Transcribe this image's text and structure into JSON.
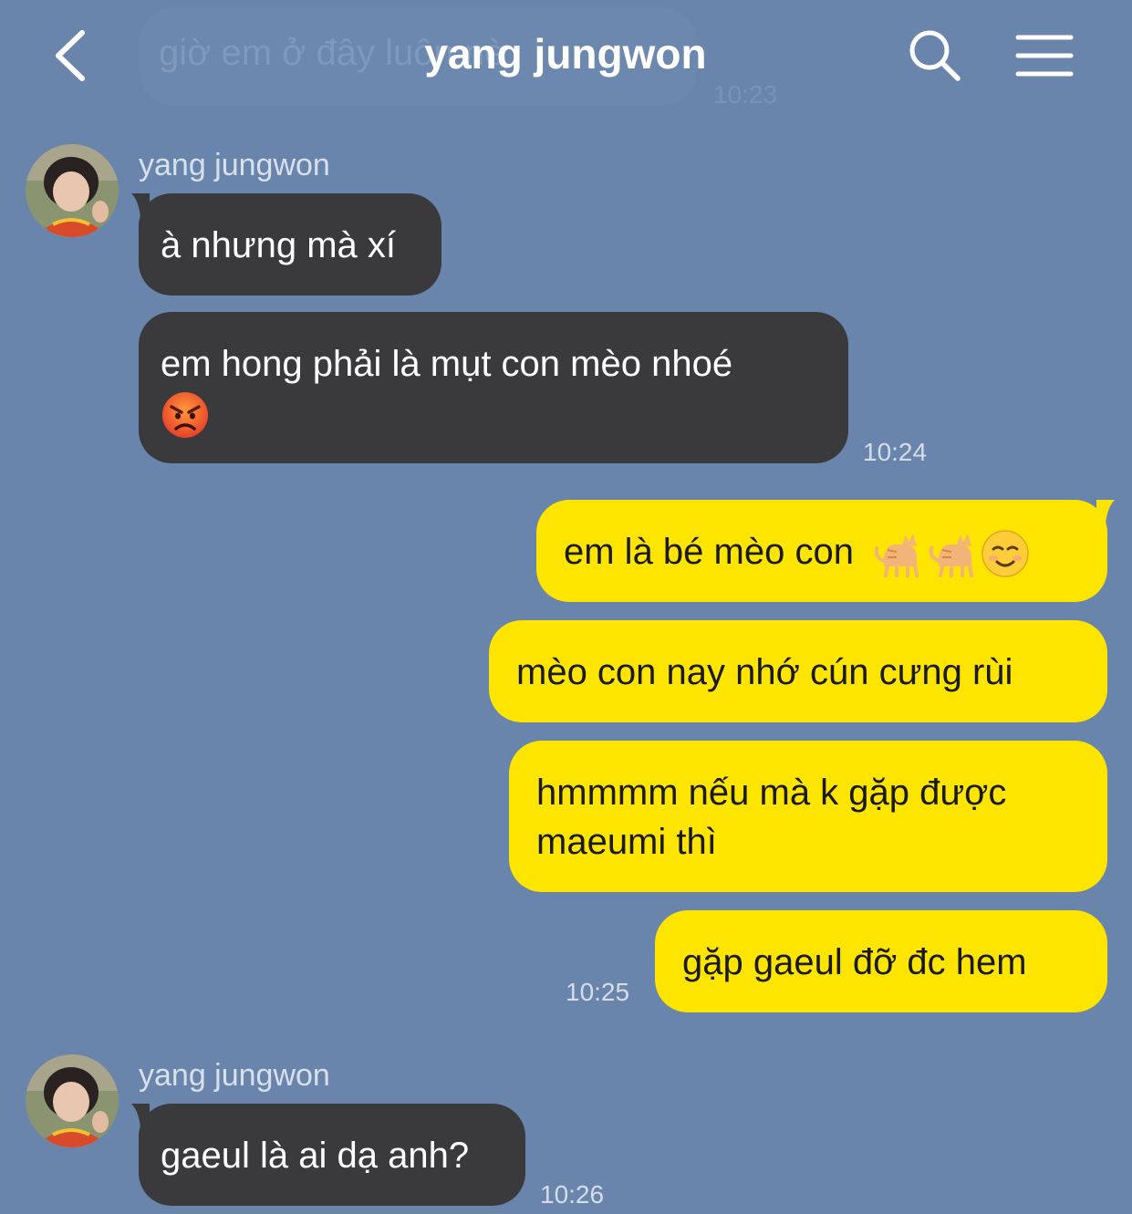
{
  "header": {
    "title": "yang jungwon",
    "back_icon": "chevron-left-icon",
    "search_icon": "search-icon",
    "menu_icon": "hamburger-menu-icon"
  },
  "ghost_message": {
    "text": "giờ em ở đây luôn nè",
    "time": "10:23"
  },
  "colors": {
    "background": "#6a85ab",
    "incoming_bubble": "#3a3a3d",
    "outgoing_bubble": "#fee500"
  },
  "messages": [
    {
      "sender": "yang jungwon",
      "direction": "incoming",
      "texts": [
        "à nhưng mà xí",
        "em hong phải là mụt con mèo nhoé"
      ],
      "emoji": [
        "angry-face-emoji"
      ],
      "time": "10:24"
    },
    {
      "direction": "outgoing",
      "texts": [
        "em là bé mèo con",
        "mèo con nay nhớ cún cưng rùi",
        "hmmmm nếu mà k gặp được maeumi thì",
        "gặp gaeul đỡ đc hem"
      ],
      "emoji": [
        "cat-emoji",
        "cat-emoji",
        "smiling-face-emoji"
      ],
      "time": "10:25"
    },
    {
      "sender": "yang jungwon",
      "direction": "incoming",
      "texts": [
        "gaeul là ai dạ anh?"
      ],
      "time": "10:26"
    }
  ]
}
